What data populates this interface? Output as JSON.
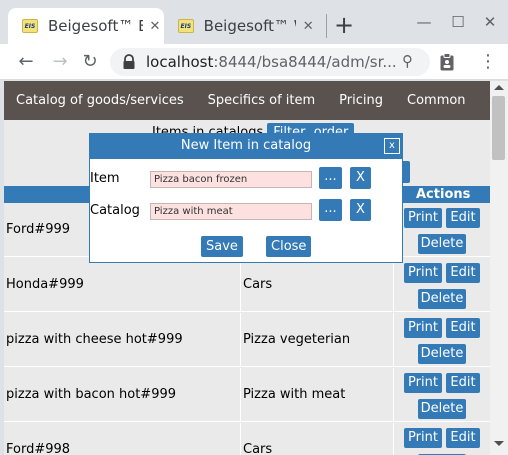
{
  "browser": {
    "tabs": [
      {
        "title": "Beigesoft™ En",
        "favicon": "EIS",
        "active": true
      },
      {
        "title": "Beigesoft™ W",
        "favicon": "EIS",
        "active": false
      }
    ],
    "url_host": "localhost",
    "url_rest": ":8444/bsa8444/adm/sr..."
  },
  "app_nav": [
    "Catalog of goods/services",
    "Specifics of item",
    "Pricing",
    "Common",
    "..."
  ],
  "list": {
    "caption": "Items in catalogs",
    "filter_button": "Filter, order",
    "actions_header": "Actions",
    "rows": [
      {
        "item": "Ford#999",
        "catalog": ""
      },
      {
        "item": "Honda#999",
        "catalog": "Cars"
      },
      {
        "item": "pizza with cheese hot#999",
        "catalog": "Pizza vegeterian"
      },
      {
        "item": "pizza with bacon hot#999",
        "catalog": "Pizza with meat"
      },
      {
        "item": "Ford#998",
        "catalog": "Cars"
      }
    ],
    "print_label": "Print",
    "edit_label": "Edit",
    "delete_label": "Delete"
  },
  "dialog": {
    "title": "New Item in catalog",
    "close_label": "x",
    "item_label": "Item",
    "item_value": "Pizza bacon frozen",
    "catalog_label": "Catalog",
    "catalog_value": "Pizza with meat",
    "pick_label": "...",
    "clear_label": "X",
    "save_label": "Save",
    "cancel_label": "Close"
  },
  "colors": {
    "accent": "#337ab7",
    "nav_bg": "#5a524f",
    "required_field": "#fde0e0"
  }
}
